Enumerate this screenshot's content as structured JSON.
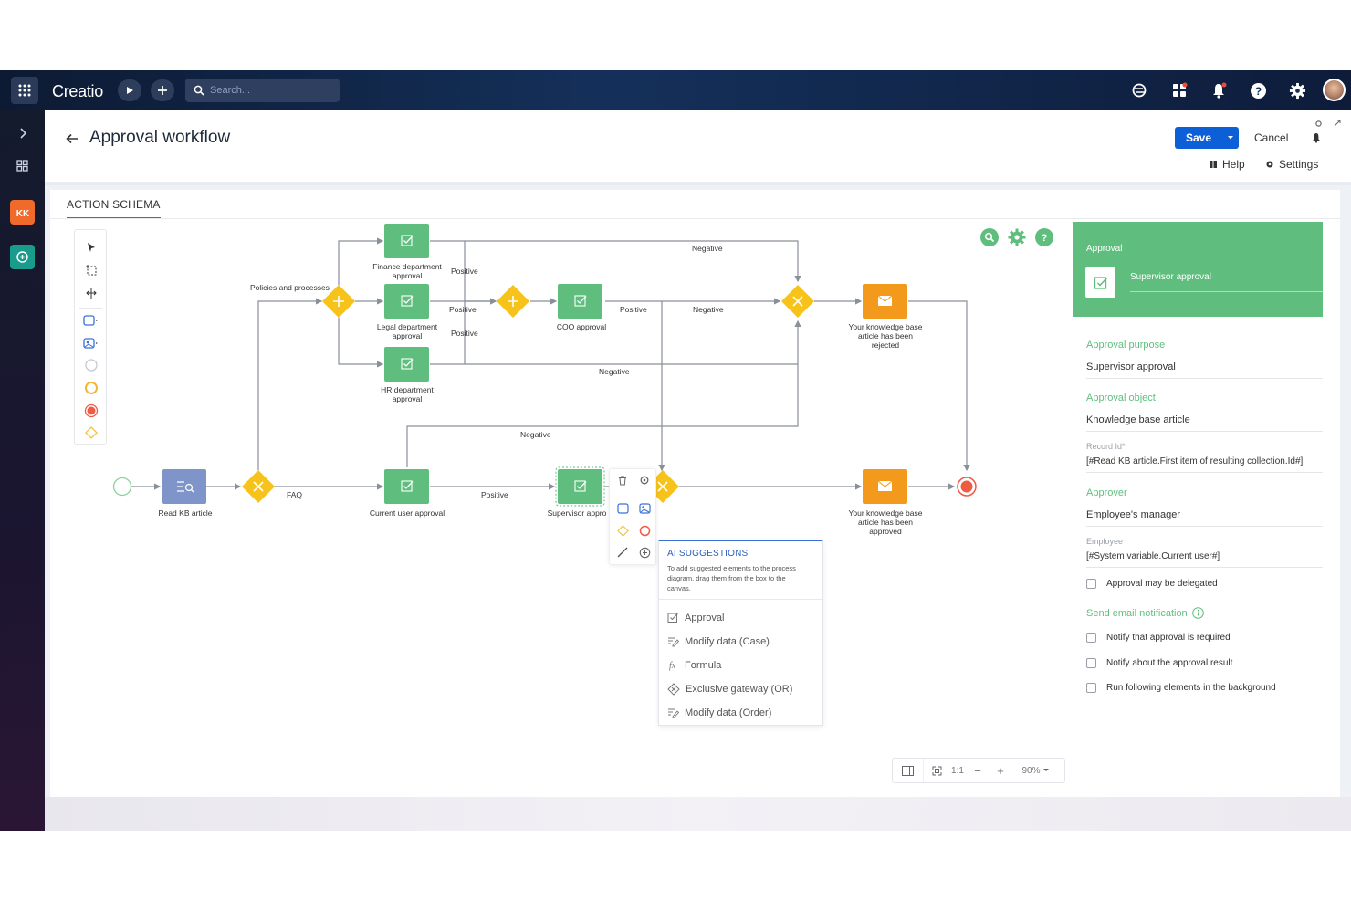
{
  "app": {
    "brand": "Creatio",
    "search_placeholder": "Search..."
  },
  "header": {
    "title": "Approval workflow",
    "save_label": "Save",
    "cancel_label": "Cancel",
    "help_label": "Help",
    "settings_label": "Settings"
  },
  "schema": {
    "tab_label": "ACTION SCHEMA"
  },
  "diagram": {
    "nodes": {
      "read_kb": "Read KB article",
      "current_user": "Current user approval",
      "supervisor": "Supervisor appro",
      "finance_1": "Finance department",
      "finance_2": "approval",
      "legal_1": "Legal department",
      "legal_2": "approval",
      "hr_1": "HR department",
      "hr_2": "approval",
      "coo": "COO approval",
      "rejected_1": "Your knowledge base",
      "rejected_2": "article has been",
      "rejected_3": "rejected",
      "approved_1": "Your knowledge base",
      "approved_2": "article has been",
      "approved_3": "approved"
    },
    "flows": {
      "policies": "Policies and processes",
      "faq": "FAQ",
      "positive": "Positive",
      "negative": "Negative"
    }
  },
  "ai_suggestions": {
    "title": "AI SUGGESTIONS",
    "description_1": "To add suggested elements to the process",
    "description_2": "diagram, drag them from the box to the",
    "description_3": "canvas.",
    "items": [
      {
        "label": "Approval",
        "icon": "approval-icon"
      },
      {
        "label": "Modify data (Case)",
        "icon": "modify-data-icon"
      },
      {
        "label": "Formula",
        "icon": "formula-icon"
      },
      {
        "label": "Exclusive gateway (OR)",
        "icon": "exclusive-gateway-icon"
      },
      {
        "label": "Modify data (Order)",
        "icon": "modify-data-icon"
      }
    ]
  },
  "properties": {
    "section": "Approval",
    "element_name": "Supervisor approval",
    "approval_purpose_label": "Approval purpose",
    "approval_purpose_value": "Supervisor approval",
    "approval_object_label": "Approval object",
    "approval_object_value": "Knowledge base article",
    "record_id_label": "Record Id*",
    "record_id_value": "[#Read KB article.First item of resulting collection.Id#]",
    "approver_label": "Approver",
    "approver_value": "Employee's manager",
    "employee_label": "Employee",
    "employee_value": "[#System variable.Current user#]",
    "delegate_label": "Approval may be delegated",
    "email_section_label": "Send email notification",
    "notify_required_label": "Notify that approval is required",
    "notify_result_label": "Notify about the approval result",
    "run_background_label": "Run following elements in the background"
  },
  "zoom": {
    "one_to_one": "1:1",
    "minus": "−",
    "plus": "+",
    "level": "90%"
  },
  "colors": {
    "accent_green": "#5fbe7d",
    "gateway_yellow": "#f7c21a",
    "message_orange": "#f39a1d",
    "primary_blue": "#0d5fd8",
    "end_red": "#ef5a42"
  }
}
